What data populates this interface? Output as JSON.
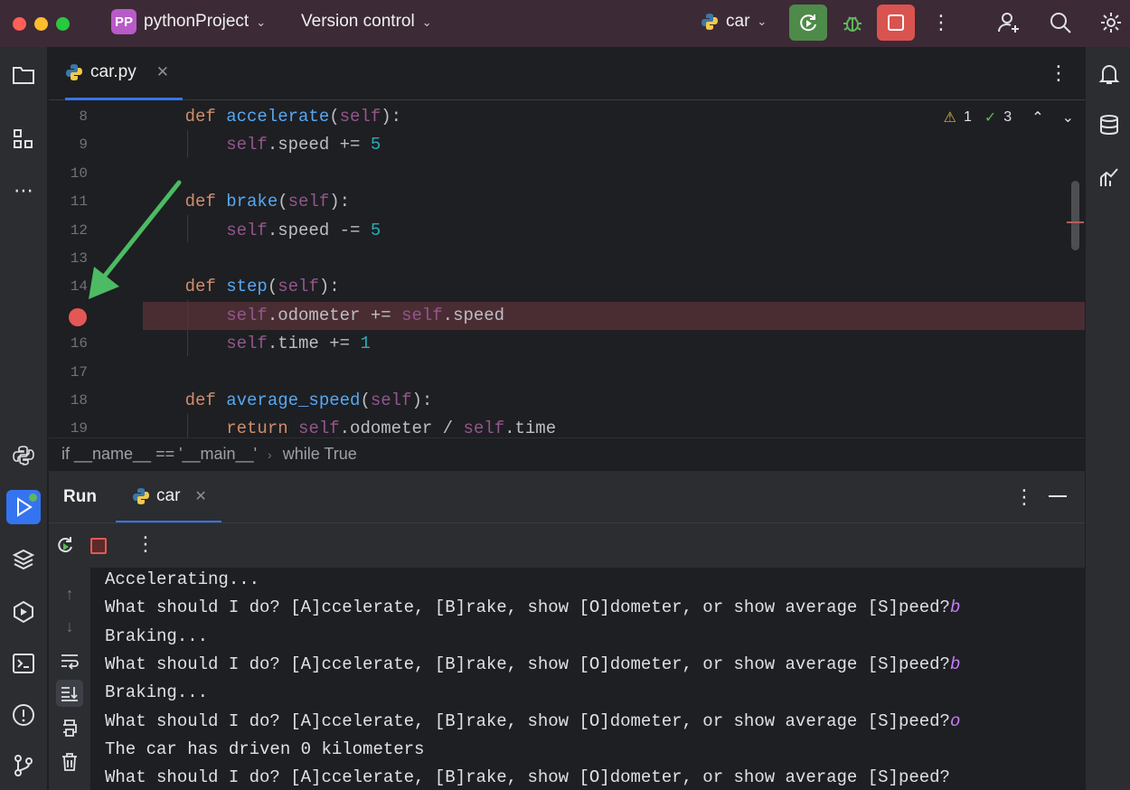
{
  "titlebar": {
    "project_badge": "PP",
    "project_name": "pythonProject",
    "vcs_label": "Version control",
    "run_config": "car",
    "colors": {
      "run_button": "#4e8a4a",
      "stop_button": "#d9534f",
      "badge": "#b85ac8"
    }
  },
  "editor": {
    "tab_label": "car.py",
    "warnings_count": "1",
    "ok_count": "3",
    "lines": [
      {
        "no": "8",
        "tokens": [
          {
            "t": "    ",
            "c": ""
          },
          {
            "t": "def ",
            "c": "k"
          },
          {
            "t": "accelerate",
            "c": "f"
          },
          {
            "t": "(",
            "c": ""
          },
          {
            "t": "self",
            "c": "s"
          },
          {
            "t": "):",
            "c": ""
          }
        ]
      },
      {
        "no": "9",
        "tokens": [
          {
            "t": "        ",
            "c": ""
          },
          {
            "t": "self",
            "c": "s"
          },
          {
            "t": ".speed += ",
            "c": ""
          },
          {
            "t": "5",
            "c": "n"
          }
        ]
      },
      {
        "no": "10",
        "tokens": []
      },
      {
        "no": "11",
        "tokens": [
          {
            "t": "    ",
            "c": ""
          },
          {
            "t": "def ",
            "c": "k"
          },
          {
            "t": "brake",
            "c": "f"
          },
          {
            "t": "(",
            "c": ""
          },
          {
            "t": "self",
            "c": "s"
          },
          {
            "t": "):",
            "c": ""
          }
        ]
      },
      {
        "no": "12",
        "tokens": [
          {
            "t": "        ",
            "c": ""
          },
          {
            "t": "self",
            "c": "s"
          },
          {
            "t": ".speed -= ",
            "c": ""
          },
          {
            "t": "5",
            "c": "n"
          }
        ]
      },
      {
        "no": "13",
        "tokens": []
      },
      {
        "no": "14",
        "tokens": [
          {
            "t": "    ",
            "c": ""
          },
          {
            "t": "def ",
            "c": "k"
          },
          {
            "t": "step",
            "c": "f"
          },
          {
            "t": "(",
            "c": ""
          },
          {
            "t": "self",
            "c": "s"
          },
          {
            "t": "):",
            "c": ""
          }
        ]
      },
      {
        "no": "",
        "tokens": [
          {
            "t": "        ",
            "c": ""
          },
          {
            "t": "self",
            "c": "s"
          },
          {
            "t": ".odometer += ",
            "c": ""
          },
          {
            "t": "self",
            "c": "s"
          },
          {
            "t": ".speed",
            "c": ""
          }
        ]
      },
      {
        "no": "16",
        "tokens": [
          {
            "t": "        ",
            "c": ""
          },
          {
            "t": "self",
            "c": "s"
          },
          {
            "t": ".time += ",
            "c": ""
          },
          {
            "t": "1",
            "c": "n"
          }
        ]
      },
      {
        "no": "17",
        "tokens": []
      },
      {
        "no": "18",
        "tokens": [
          {
            "t": "    ",
            "c": ""
          },
          {
            "t": "def ",
            "c": "k"
          },
          {
            "t": "average_speed",
            "c": "f"
          },
          {
            "t": "(",
            "c": ""
          },
          {
            "t": "self",
            "c": "s"
          },
          {
            "t": "):",
            "c": ""
          }
        ]
      },
      {
        "no": "19",
        "tokens": [
          {
            "t": "        ",
            "c": ""
          },
          {
            "t": "return ",
            "c": "k"
          },
          {
            "t": "self",
            "c": "s"
          },
          {
            "t": ".odometer / ",
            "c": ""
          },
          {
            "t": "self",
            "c": "s"
          },
          {
            "t": ".time",
            "c": ""
          }
        ]
      }
    ]
  },
  "breadcrumbs": [
    "if __name__ == '__main__'",
    "while True"
  ],
  "run_panel": {
    "title": "Run",
    "tab_label": "car",
    "console_lines": [
      {
        "text": "Accelerating...",
        "input": ""
      },
      {
        "text": "What should I do? [A]ccelerate, [B]rake, show [O]dometer, or show average [S]peed?",
        "input": "b"
      },
      {
        "text": "Braking...",
        "input": ""
      },
      {
        "text": "What should I do? [A]ccelerate, [B]rake, show [O]dometer, or show average [S]peed?",
        "input": "b"
      },
      {
        "text": "Braking...",
        "input": ""
      },
      {
        "text": "What should I do? [A]ccelerate, [B]rake, show [O]dometer, or show average [S]peed?",
        "input": "o"
      },
      {
        "text": "The car has driven 0 kilometers",
        "input": ""
      },
      {
        "text": "What should I do? [A]ccelerate, [B]rake, show [O]dometer, or show average [S]peed?",
        "input": ""
      }
    ]
  }
}
